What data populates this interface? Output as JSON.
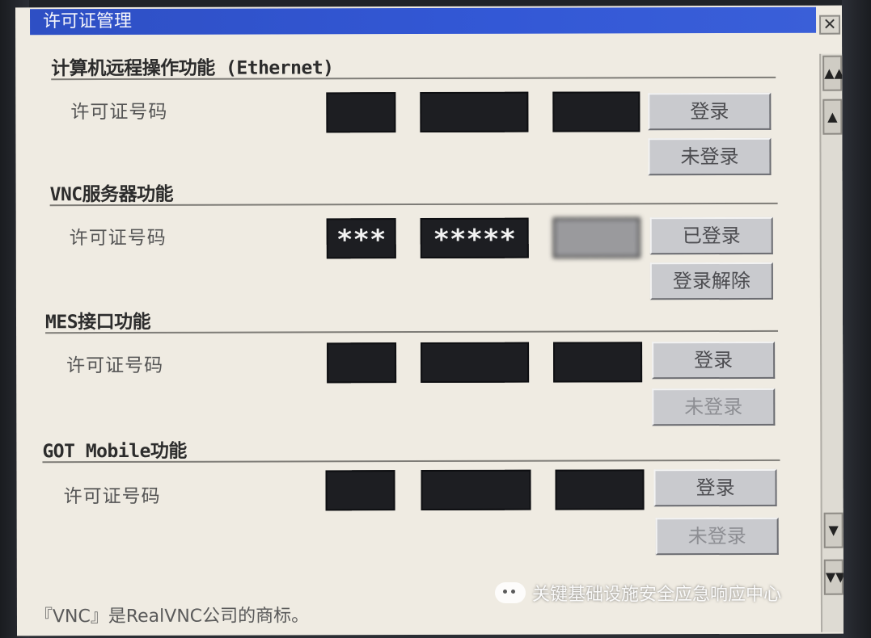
{
  "window": {
    "title": "许可证管理",
    "close_glyph": "✕"
  },
  "sections": [
    {
      "title": "计算机远程操作功能 (Ethernet)",
      "field_label": "许可证号码",
      "fields": [
        "",
        "",
        ""
      ],
      "buttons": [
        {
          "label": "登录",
          "enabled": true
        },
        {
          "label": "未登录",
          "enabled": true
        }
      ]
    },
    {
      "title": "VNC服务器功能",
      "field_label": "许可证号码",
      "fields": [
        "***",
        "*****",
        ""
      ],
      "buttons": [
        {
          "label": "已登录",
          "enabled": true
        },
        {
          "label": "登录解除",
          "enabled": true
        }
      ]
    },
    {
      "title": "MES接口功能",
      "field_label": "许可证号码",
      "fields": [
        "",
        "",
        ""
      ],
      "buttons": [
        {
          "label": "登录",
          "enabled": true
        },
        {
          "label": "未登录",
          "enabled": false
        }
      ]
    },
    {
      "title": "GOT Mobile功能",
      "field_label": "许可证号码",
      "fields": [
        "",
        "",
        ""
      ],
      "buttons": [
        {
          "label": "登录",
          "enabled": true
        },
        {
          "label": "未登录",
          "enabled": false
        }
      ]
    }
  ],
  "scrollbar": {
    "page_up_icon": "▲▲",
    "line_up_icon": "▲",
    "line_down_icon": "▼",
    "page_down_icon": "▼▼"
  },
  "footer": {
    "note": "『VNC』是RealVNC公司的商标。"
  },
  "watermark": {
    "text": "关键基础设施安全应急响应中心"
  },
  "colors": {
    "title_bar": "#3358d6",
    "panel_bg": "#efebe2",
    "field_bg": "#1d1e22",
    "button_bg": "#c9cace"
  }
}
